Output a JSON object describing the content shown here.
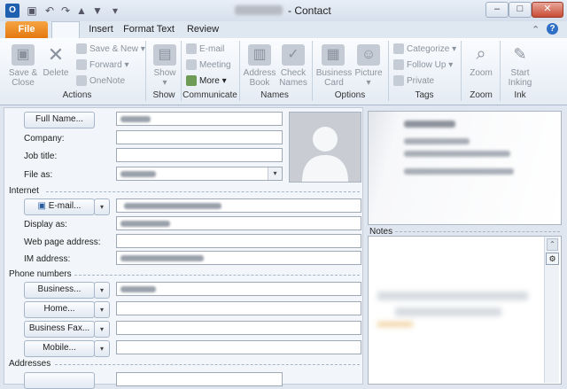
{
  "window": {
    "title_suffix": "- Contact",
    "buttons": {
      "minimize": "–",
      "maximize": "□",
      "close": "✕"
    }
  },
  "quick_access": [
    "save-icon",
    "undo-icon",
    "redo-icon",
    "up-icon",
    "down-icon",
    "customize-icon"
  ],
  "tabs": {
    "file": "File",
    "contact": "",
    "insert": "Insert",
    "format_text": "Format Text",
    "review": "Review"
  },
  "ribbon": {
    "actions": {
      "label": "Actions",
      "save_close_1": "Save &",
      "save_close_2": "Close",
      "delete": "Delete",
      "save_new": "Save & New",
      "forward": "Forward",
      "onenote": "OneNote"
    },
    "show": {
      "label": "Show",
      "show_btn": "Show"
    },
    "communicate": {
      "label": "Communicate",
      "email": "E-mail",
      "meeting": "Meeting",
      "more": "More"
    },
    "names": {
      "label": "Names",
      "address_1": "Address",
      "address_2": "Book",
      "check_1": "Check",
      "check_2": "Names"
    },
    "options": {
      "label": "Options",
      "business_1": "Business",
      "business_2": "Card",
      "picture": "Picture"
    },
    "tags": {
      "label": "Tags",
      "categorize": "Categorize",
      "follow_up": "Follow Up",
      "private": "Private"
    },
    "zoom": {
      "label": "Zoom",
      "zoom_btn": "Zoom"
    },
    "ink": {
      "label": "Ink",
      "start_1": "Start",
      "start_2": "Inking"
    }
  },
  "form": {
    "full_name_btn": "Full Name...",
    "company_label": "Company:",
    "job_title_label": "Job title:",
    "file_as_label": "File as:",
    "internet_section": "Internet",
    "email_btn": "E-mail...",
    "display_as_label": "Display as:",
    "web_label": "Web page address:",
    "im_label": "IM address:",
    "phone_section": "Phone numbers",
    "business_btn": "Business...",
    "home_btn": "Home...",
    "business_fax_btn": "Business Fax...",
    "mobile_btn": "Mobile...",
    "addresses_section": "Addresses",
    "notes_label": "Notes"
  }
}
